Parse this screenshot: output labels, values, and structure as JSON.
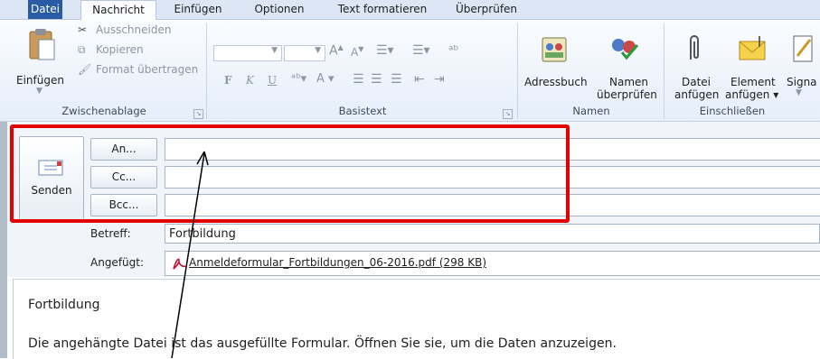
{
  "tabs": {
    "file": "Datei",
    "message": "Nachricht",
    "insert": "Einfügen",
    "options": "Optionen",
    "format_text": "Text formatieren",
    "review": "Überprüfen"
  },
  "clipboard": {
    "paste": "Einfügen",
    "cut": "Ausschneiden",
    "copy": "Kopieren",
    "format_painter": "Format übertragen",
    "group_label": "Zwischenablage"
  },
  "basic_text": {
    "bold": "F",
    "italic": "K",
    "underline": "U",
    "group_label": "Basistext"
  },
  "names": {
    "address_book": "Adressbuch",
    "check_names_line1": "Namen",
    "check_names_line2": "überprüfen",
    "group_label": "Namen"
  },
  "include": {
    "attach_file_line1": "Datei",
    "attach_file_line2": "anfügen",
    "attach_item_line1": "Element",
    "attach_item_line2": "anfügen ▾",
    "signature": "Signa",
    "group_label": "Einschließen"
  },
  "compose": {
    "send": "Senden",
    "to_button": "An...",
    "cc_button": "Cc...",
    "bcc_button": "Bcc...",
    "to_value": "",
    "cc_value": "",
    "bcc_value": "",
    "subject_label": "Betreff:",
    "subject_value": "Fortbildung",
    "attached_label": "Angefügt:",
    "attachment_name": "Anmeldeformular_Fortbildungen_06-2016.pdf (298 KB)"
  },
  "body": {
    "line1": "Fortbildung",
    "line2": "Die angehängte Datei ist das ausgefüllte Formular. Öffnen Sie sie, um die Daten anzuzeigen."
  },
  "colors": {
    "file_tab": "#2a5ca5",
    "highlight_box": "#e50000",
    "ribbon_bg": "#e6eef9"
  }
}
